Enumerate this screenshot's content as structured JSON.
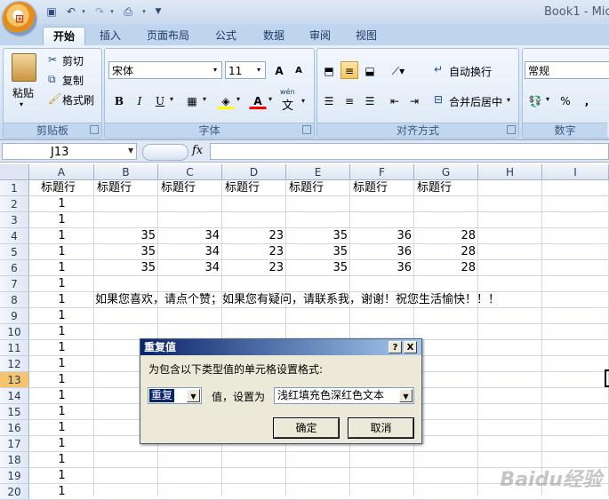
{
  "app": {
    "title": "Book1 - Mic"
  },
  "ribbon_tabs": [
    "开始",
    "插入",
    "页面布局",
    "公式",
    "数据",
    "审阅",
    "视图"
  ],
  "clipboard": {
    "paste": "粘贴",
    "cut": "剪切",
    "copy": "复制",
    "format_painter": "格式刷",
    "group_label": "剪贴板"
  },
  "font": {
    "name": "宋体",
    "size": "11",
    "grow": "A",
    "shrink": "A",
    "bold": "B",
    "italic": "I",
    "underline": "U",
    "font_color": "A",
    "phonetic": "wén",
    "phonetic_char": "文",
    "group_label": "字体"
  },
  "alignment": {
    "wrap_text": "自动换行",
    "merge_center": "合并后居中",
    "group_label": "对齐方式"
  },
  "number": {
    "format": "常规",
    "percent": "%",
    "comma": ",",
    "group_label": "数字"
  },
  "formula_bar": {
    "name_box": "J13",
    "fx": "fx"
  },
  "columns": [
    "A",
    "B",
    "C",
    "D",
    "E",
    "F",
    "G",
    "H",
    "I"
  ],
  "rows": [
    "1",
    "2",
    "3",
    "4",
    "5",
    "6",
    "7",
    "8",
    "9",
    "10",
    "11",
    "12",
    "13",
    "14",
    "15",
    "16",
    "17",
    "18",
    "19",
    "20"
  ],
  "selected_row": "13",
  "cells": {
    "headers": [
      "标题行",
      "标题行",
      "标题行",
      "标题行",
      "标题行",
      "标题行",
      "标题行"
    ],
    "a_values": [
      "1",
      "1",
      "1",
      "1",
      "1",
      "1",
      "1",
      "1",
      "1",
      "1",
      "1",
      "1",
      "1",
      "1",
      "1",
      "1",
      "1",
      "1",
      "1"
    ],
    "data_rows": [
      [
        "35",
        "34",
        "23",
        "35",
        "36",
        "28"
      ],
      [
        "35",
        "34",
        "23",
        "35",
        "36",
        "28"
      ],
      [
        "35",
        "34",
        "23",
        "35",
        "36",
        "28"
      ]
    ],
    "b8_text": "如果您喜欢，请点个赞；如果您有疑问，请联系我，谢谢！祝您生活愉快！！！"
  },
  "dialog": {
    "title": "重复值",
    "help": "?",
    "close": "X",
    "prompt": "为包含以下类型值的单元格设置格式:",
    "type_value": "重复",
    "middle_label": "值，设置为",
    "format_value": "浅红填充色深红色文本",
    "ok": "确定",
    "cancel": "取消"
  },
  "watermark": "Baidu经验"
}
